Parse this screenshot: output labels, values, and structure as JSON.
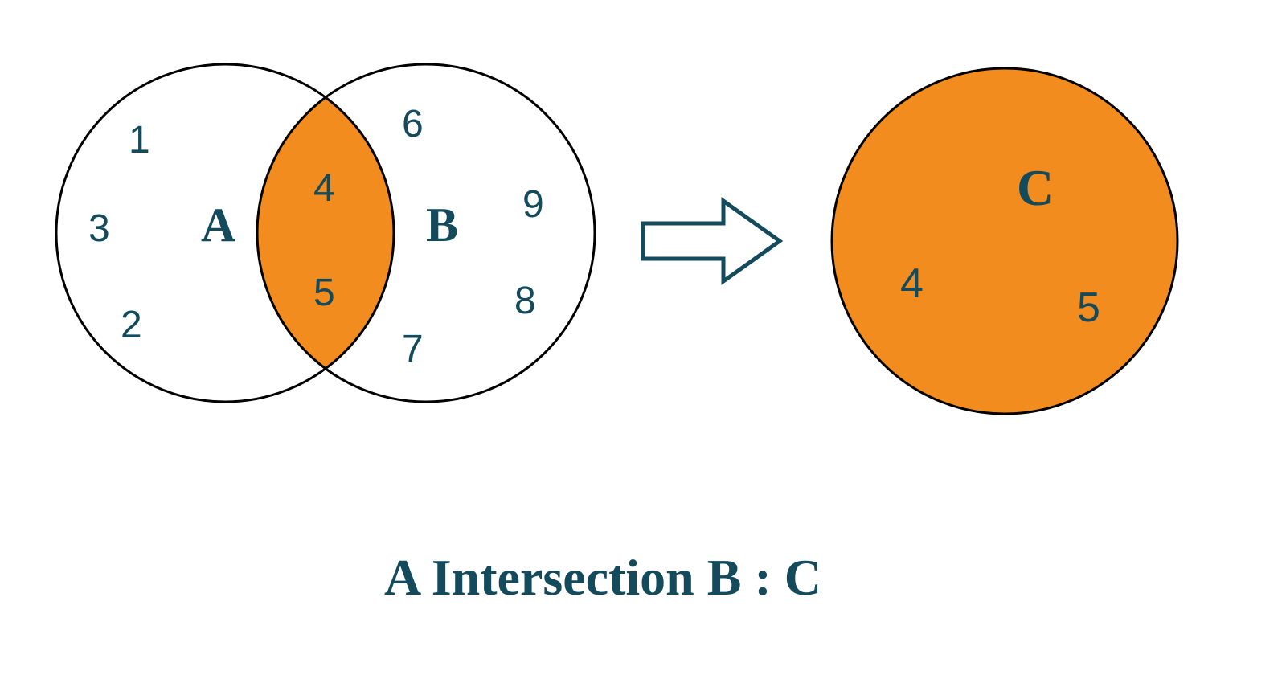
{
  "sets": {
    "A": {
      "label": "A",
      "only": [
        "1",
        "3",
        "2"
      ]
    },
    "B": {
      "label": "B",
      "only": [
        "6",
        "9",
        "8",
        "7"
      ]
    },
    "intersection": [
      "4",
      "5"
    ],
    "C": {
      "label": "C",
      "members": [
        "4",
        "5"
      ]
    }
  },
  "caption": "A Intersection B : C",
  "colors": {
    "highlight": "#f28c1f",
    "stroke": "#000000",
    "text": "#134a5c",
    "arrowFill": "#ffffff"
  }
}
